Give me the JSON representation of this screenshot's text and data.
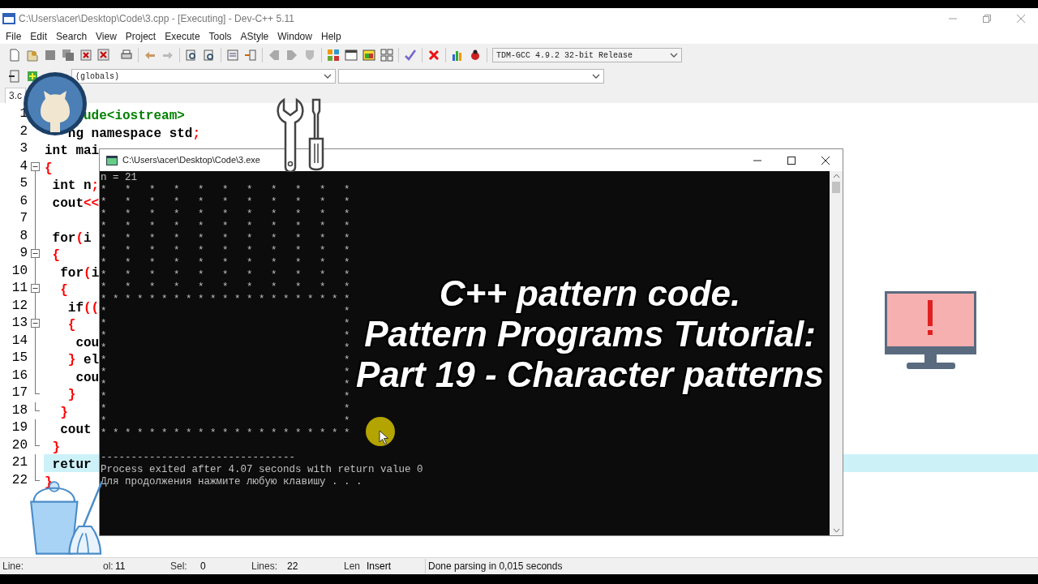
{
  "window": {
    "title": "C:\\Users\\acer\\Desktop\\Code\\3.cpp - [Executing] - Dev-C++ 5.11"
  },
  "menu": [
    "File",
    "Edit",
    "Search",
    "View",
    "Project",
    "Execute",
    "Tools",
    "AStyle",
    "Window",
    "Help"
  ],
  "compiler_select": {
    "value": "TDM-GCC 4.9.2 32-bit Release"
  },
  "scope_select": {
    "value": "(globals)"
  },
  "tab": {
    "label": "3.c"
  },
  "editor": {
    "lines": [
      {
        "number": "1",
        "kind": "plain",
        "current": false,
        "tokens": [
          {
            "kind": "preproc",
            "text": "     ude<iostream>"
          }
        ]
      },
      {
        "number": "2",
        "kind": "plain",
        "current": false,
        "tokens": [
          {
            "kind": "plain",
            "text": "   ng namespace std"
          },
          {
            "kind": "punct",
            "text": ";"
          }
        ]
      },
      {
        "number": "3",
        "kind": "plain",
        "current": false,
        "tokens": [
          {
            "kind": "plain",
            "text": "int mai"
          }
        ]
      },
      {
        "number": "4",
        "kind": "fold-open",
        "current": false,
        "tokens": [
          {
            "kind": "punct",
            "text": "{"
          }
        ]
      },
      {
        "number": "5",
        "kind": "fold-line",
        "current": false,
        "tokens": [
          {
            "kind": "plain",
            "text": " int n"
          },
          {
            "kind": "punct",
            "text": ";"
          }
        ]
      },
      {
        "number": "6",
        "kind": "fold-line",
        "current": false,
        "tokens": [
          {
            "kind": "plain",
            "text": " cout"
          },
          {
            "kind": "punct",
            "text": "<<"
          }
        ]
      },
      {
        "number": "7",
        "kind": "fold-line",
        "current": false
      },
      {
        "number": "8",
        "kind": "fold-line",
        "current": false,
        "tokens": [
          {
            "kind": "plain",
            "text": " for"
          },
          {
            "kind": "punct",
            "text": "("
          },
          {
            "kind": "plain",
            "text": "i"
          }
        ]
      },
      {
        "number": "9",
        "kind": "fold-open",
        "current": false,
        "tokens": [
          {
            "kind": "punct",
            "text": " {"
          }
        ]
      },
      {
        "number": "10",
        "kind": "fold-line",
        "current": false,
        "tokens": [
          {
            "kind": "plain",
            "text": "  for"
          },
          {
            "kind": "punct",
            "text": "("
          },
          {
            "kind": "plain",
            "text": "i"
          }
        ]
      },
      {
        "number": "11",
        "kind": "fold-open",
        "current": false,
        "tokens": [
          {
            "kind": "punct",
            "text": "  {"
          }
        ]
      },
      {
        "number": "12",
        "kind": "fold-line",
        "current": false,
        "tokens": [
          {
            "kind": "plain",
            "text": "   if"
          },
          {
            "kind": "punct",
            "text": "(("
          }
        ]
      },
      {
        "number": "13",
        "kind": "fold-open",
        "current": false,
        "tokens": [
          {
            "kind": "punct",
            "text": "   {"
          }
        ]
      },
      {
        "number": "14",
        "kind": "fold-line",
        "current": false,
        "tokens": [
          {
            "kind": "plain",
            "text": "    cou"
          }
        ]
      },
      {
        "number": "15",
        "kind": "fold-line",
        "current": false,
        "tokens": [
          {
            "kind": "punct",
            "text": "   }"
          },
          {
            "kind": "plain",
            "text": " el"
          }
        ]
      },
      {
        "number": "16",
        "kind": "fold-line",
        "current": false,
        "tokens": [
          {
            "kind": "plain",
            "text": "    cou"
          }
        ]
      },
      {
        "number": "17",
        "kind": "fold-end",
        "current": false,
        "tokens": [
          {
            "kind": "punct",
            "text": "   }"
          }
        ]
      },
      {
        "number": "18",
        "kind": "fold-end",
        "current": false,
        "tokens": [
          {
            "kind": "punct",
            "text": "  }"
          }
        ]
      },
      {
        "number": "19",
        "kind": "fold-line",
        "current": false,
        "tokens": [
          {
            "kind": "plain",
            "text": "  cout"
          }
        ]
      },
      {
        "number": "20",
        "kind": "fold-end",
        "current": false,
        "tokens": [
          {
            "kind": "punct",
            "text": " }"
          }
        ]
      },
      {
        "number": "21",
        "kind": "fold-line",
        "current": true,
        "tokens": [
          {
            "kind": "plain",
            "text": " retur"
          }
        ]
      },
      {
        "number": "22",
        "kind": "fold-end",
        "current": false,
        "tokens": [
          {
            "kind": "punct",
            "text": "}"
          }
        ]
      }
    ]
  },
  "console": {
    "title": "C:\\Users\\acer\\Desktop\\Code\\3.exe",
    "output": "n = 21\n*   *   *   *   *   *   *   *   *   *   *\n*   *   *   *   *   *   *   *   *   *   *\n*   *   *   *   *   *   *   *   *   *   *\n*   *   *   *   *   *   *   *   *   *   *\n*   *   *   *   *   *   *   *   *   *   *\n*   *   *   *   *   *   *   *   *   *   *\n*   *   *   *   *   *   *   *   *   *   *\n*   *   *   *   *   *   *   *   *   *   *\n*   *   *   *   *   *   *   *   *   *   *\n* * * * * * * * * * * * * * * * * * * * *\n*                                       *\n*                                       *\n*                                       *\n*                                       *\n*                                       *\n*                                       *\n*                                       *\n*                                       *\n*                                       *\n*                                       *\n* * * * * * * * * * * * * * * * * * * * *",
    "footer": [
      "--------------------------------",
      "Process exited after 4.07 seconds with return value 0",
      "Для продолжения нажмите любую клавишу . . ."
    ]
  },
  "caption": [
    "C++ pattern code.",
    "Pattern Programs Tutorial:",
    "Part 19 - Character patterns"
  ],
  "status_bar": [
    {
      "kind": "label",
      "text": "Line:"
    },
    {
      "kind": "label",
      "text": "ol:"
    },
    {
      "kind": "value",
      "text": "11"
    },
    {
      "kind": "label",
      "text": "Sel:"
    },
    {
      "kind": "value",
      "text": "0"
    },
    {
      "kind": "label",
      "text": "Lines:"
    },
    {
      "kind": "value",
      "text": "22"
    },
    {
      "kind": "label",
      "text": "Len"
    },
    {
      "kind": "value",
      "text": "Insert"
    },
    {
      "kind": "message",
      "text": "Done parsing in 0,015 seconds"
    }
  ]
}
